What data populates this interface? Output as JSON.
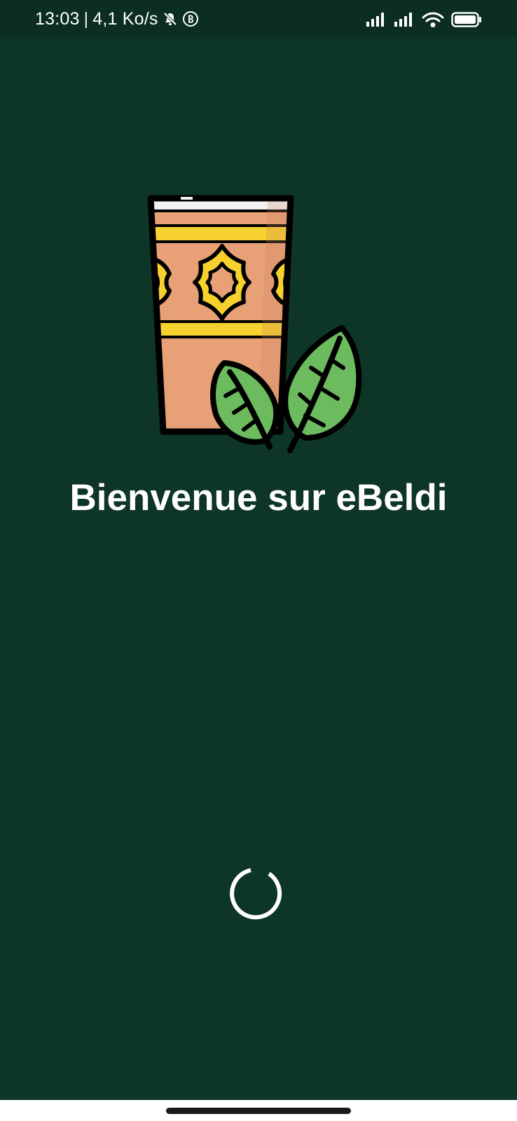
{
  "status_bar": {
    "time": "13:03",
    "separator": "|",
    "network_speed": "4,1 Ko/s",
    "icons": [
      "mute-bell-icon",
      "b-badge-icon",
      "signal-icon",
      "signal-icon",
      "wifi-icon",
      "battery-icon"
    ]
  },
  "splash": {
    "logo_icon": "mint-tea-glass-icon",
    "title": "Bienvenue sur eBeldi",
    "loading_icon": "loading-spinner-icon"
  },
  "colors": {
    "background": "#0e3627",
    "status_bar": "#0b2e20",
    "text": "#ffffff",
    "glass": "#e8a077",
    "pattern": "#f7d12e",
    "leaf": "#6dbb5f"
  }
}
